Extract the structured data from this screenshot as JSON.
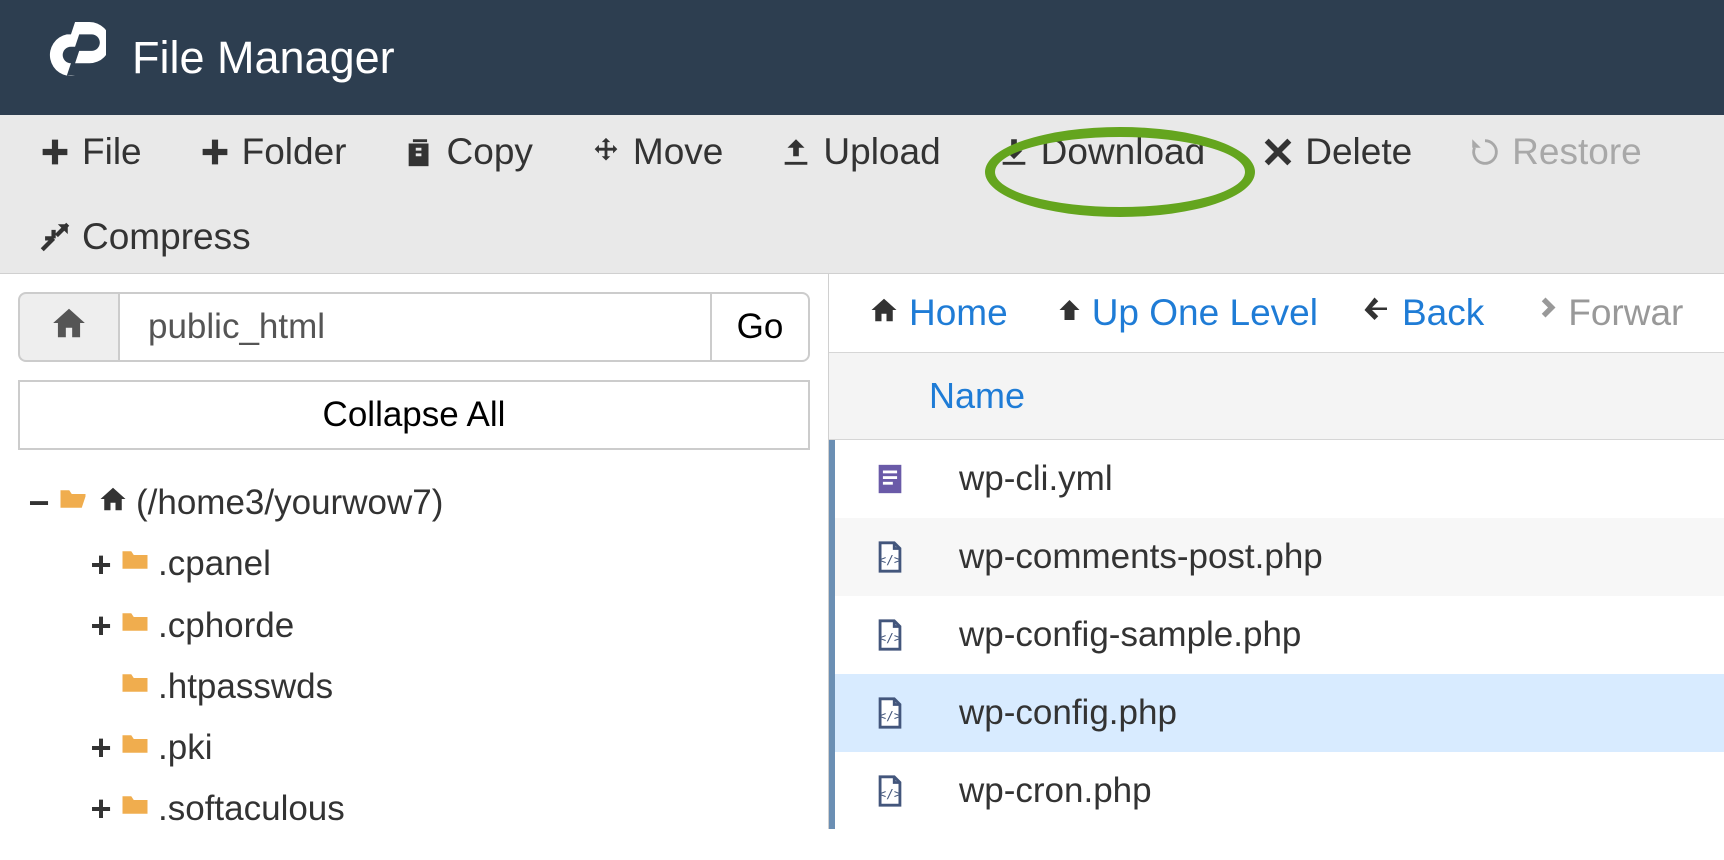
{
  "header": {
    "title": "File Manager"
  },
  "toolbar": {
    "file": "File",
    "folder": "Folder",
    "copy": "Copy",
    "move": "Move",
    "upload": "Upload",
    "download": "Download",
    "delete": "Delete",
    "restore": "Restore",
    "compress": "Compress"
  },
  "path": {
    "value": "public_html",
    "go": "Go"
  },
  "collapse_all": "Collapse All",
  "tree": {
    "root": {
      "label": "(/home3/yourwow7)"
    },
    "items": [
      {
        "label": ".cpanel",
        "expandable": true
      },
      {
        "label": ".cphorde",
        "expandable": true
      },
      {
        "label": ".htpasswds",
        "expandable": false
      },
      {
        "label": ".pki",
        "expandable": true
      },
      {
        "label": ".softaculous",
        "expandable": true
      }
    ]
  },
  "nav": {
    "home": "Home",
    "up": "Up One Level",
    "back": "Back",
    "forward": "Forwar"
  },
  "columns": {
    "name": "Name"
  },
  "files": [
    {
      "name": "wp-cli.yml",
      "type": "yml",
      "selected": false
    },
    {
      "name": "wp-comments-post.php",
      "type": "php",
      "selected": false
    },
    {
      "name": "wp-config-sample.php",
      "type": "php",
      "selected": false
    },
    {
      "name": "wp-config.php",
      "type": "php",
      "selected": true
    },
    {
      "name": "wp-cron.php",
      "type": "php",
      "selected": false
    }
  ],
  "highlighted_button": "download"
}
